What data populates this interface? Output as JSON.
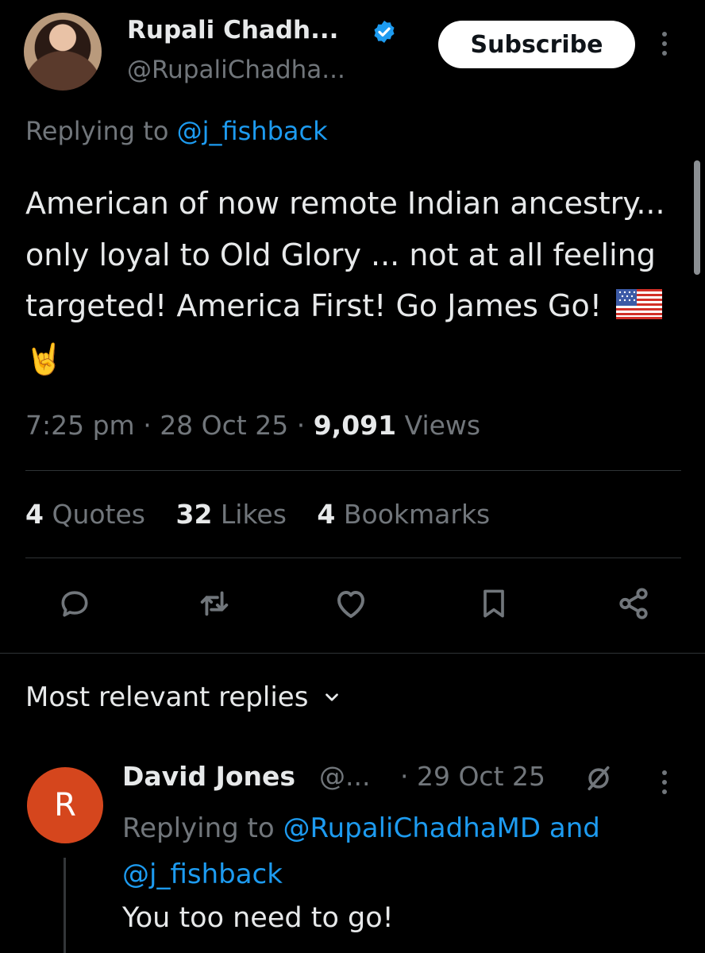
{
  "post": {
    "author_name": "Rupali Chadh...",
    "author_handle": "@RupaliChadha...",
    "subscribe_label": "Subscribe",
    "replying_prefix": "Replying to",
    "replying_to": "@j_fishback",
    "text": "American of now remote Indian ancestry... only loyal to Old Glory ... not at all feeling targeted! America First! Go James Go!",
    "emoji_flag": "flag-us-icon",
    "emoji_hand": "🤘",
    "time": "7:25 pm",
    "date": "28 Oct 25",
    "views_count": "9,091",
    "views_label": "Views",
    "quotes_count": "4",
    "quotes_label": "Quotes",
    "likes_count": "32",
    "likes_label": "Likes",
    "bookmarks_count": "4",
    "bookmarks_label": "Bookmarks"
  },
  "replies_section": {
    "title": "Most relevant replies"
  },
  "reply": {
    "avatar_letter": "R",
    "name": "David Jones",
    "handle": "@...",
    "date": "· 29 Oct 25",
    "replying_prefix": "Replying to",
    "replying_to_1": "@RupaliChadhaMD",
    "and_word": "and",
    "replying_to_2": "@j_fishback",
    "text": "You too need to go!"
  },
  "colors": {
    "background": "#000000",
    "text": "#e7e9ea",
    "muted": "#71767b",
    "link": "#1d9bf0",
    "verified": "#1d9bf0",
    "reply_avatar": "#d5461d"
  }
}
